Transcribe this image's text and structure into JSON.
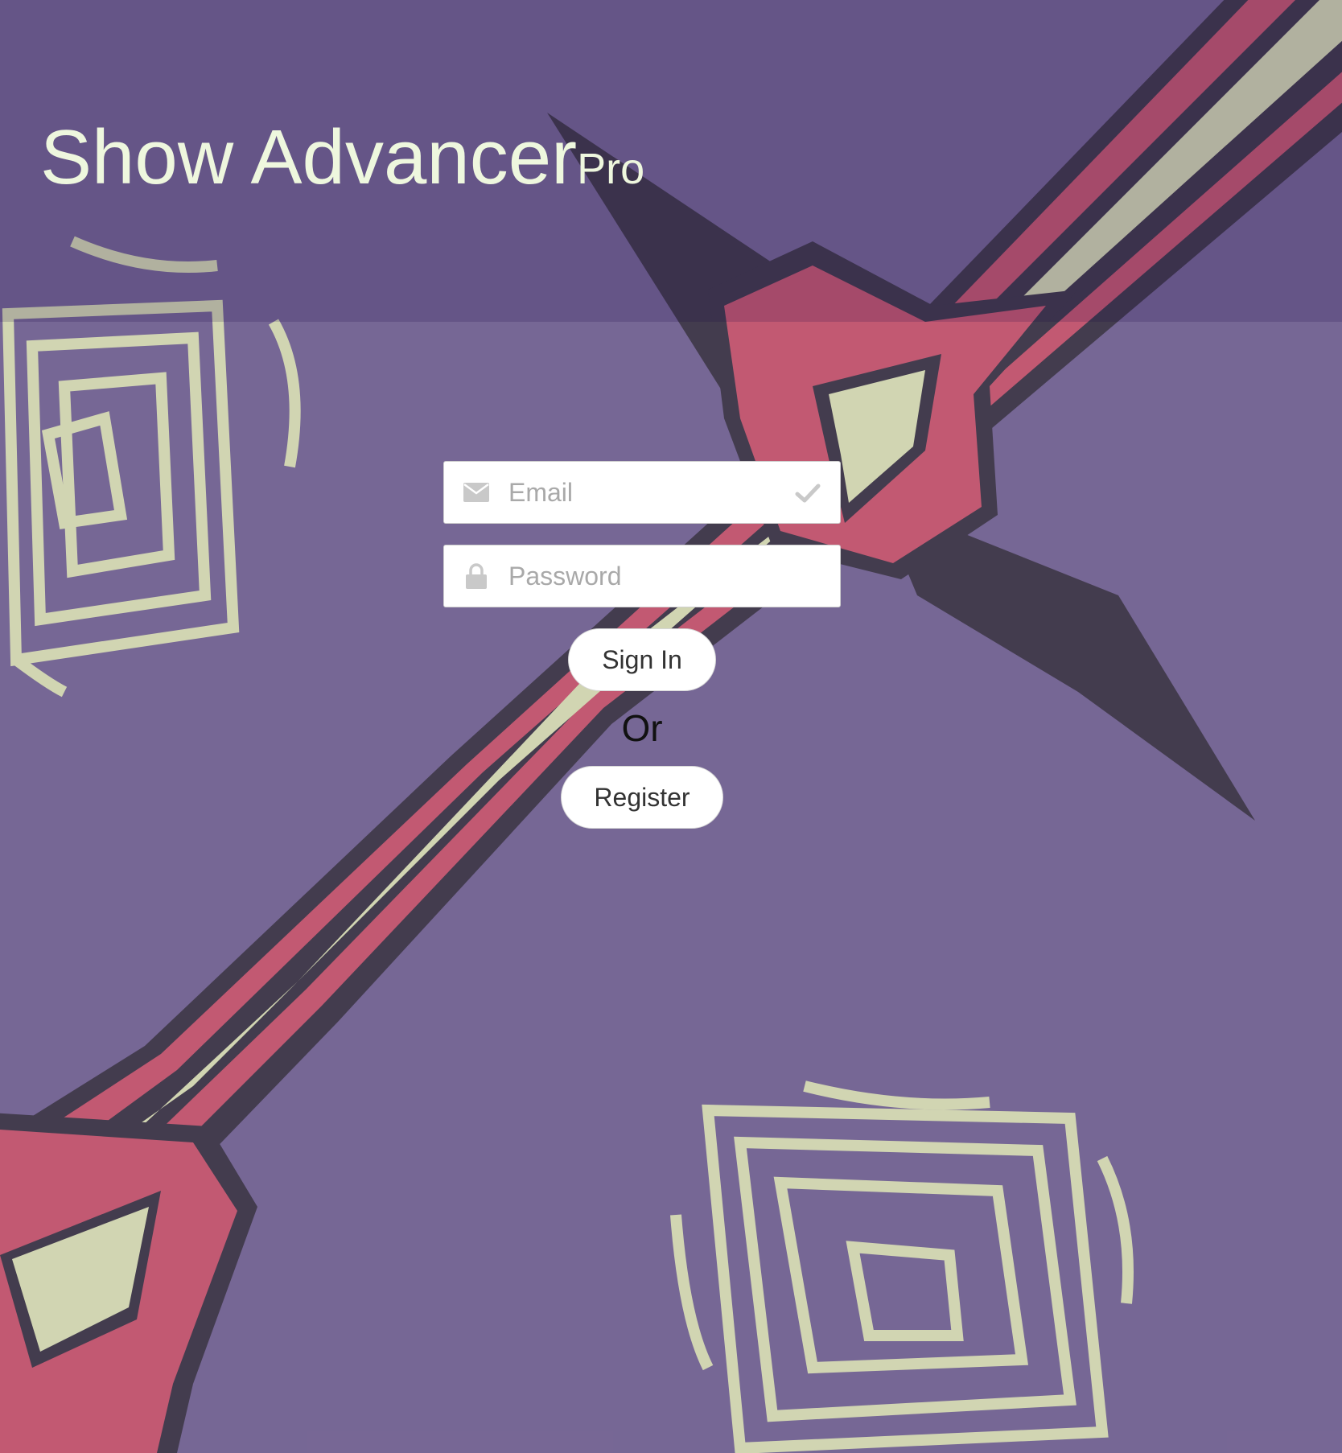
{
  "app": {
    "title_main": "Show Advancer",
    "title_suffix": "Pro"
  },
  "login": {
    "email_placeholder": "Email",
    "password_placeholder": "Password",
    "sign_in_label": "Sign In",
    "or_label": "Or",
    "register_label": "Register"
  },
  "icons": {
    "email": "envelope-icon",
    "email_valid": "checkmark-icon",
    "password": "lock-icon"
  },
  "colors": {
    "background_purple": "#6a5a8a",
    "title_text": "#eef7de",
    "pattern_red": "#cc4a5e",
    "pattern_cream": "#dfe8b0",
    "pattern_outline": "#2a2530"
  }
}
